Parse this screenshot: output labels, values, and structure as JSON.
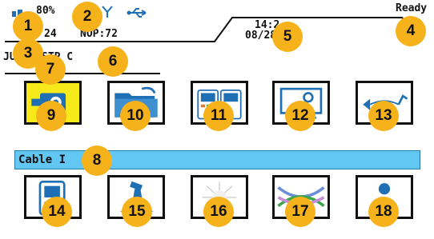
{
  "status": {
    "battery_pct": "80%",
    "unknown_value": "24",
    "nop": "NOP:72",
    "time": "14:2",
    "date": "08/28/1",
    "ready": "Ready",
    "test_label": "JU",
    "cable_type": "STP C"
  },
  "cable_bar": {
    "text": "Cable I"
  },
  "badges": [
    "1",
    "2",
    "3",
    "4",
    "5",
    "6",
    "7",
    "8",
    "9",
    "10",
    "11",
    "12",
    "13",
    "14",
    "15",
    "16",
    "17",
    "18"
  ],
  "tiles": [
    {
      "icon": "camera-icon",
      "selected": true
    },
    {
      "icon": "folder-icon"
    },
    {
      "icon": "testers-icon"
    },
    {
      "icon": "monitor-settings-icon"
    },
    {
      "icon": "cable-link-icon"
    },
    {
      "icon": "handheld-device-icon"
    },
    {
      "icon": "weight-scale-icon"
    },
    {
      "icon": "sun-light-icon"
    },
    {
      "icon": "crossed-wires-icon"
    },
    {
      "icon": "person-icon"
    }
  ],
  "colors": {
    "accent_blue": "#1f6fb5",
    "highlight_yellow": "#f6ea1a",
    "bar_blue": "#63c7f3",
    "badge": "#f6b21b"
  }
}
